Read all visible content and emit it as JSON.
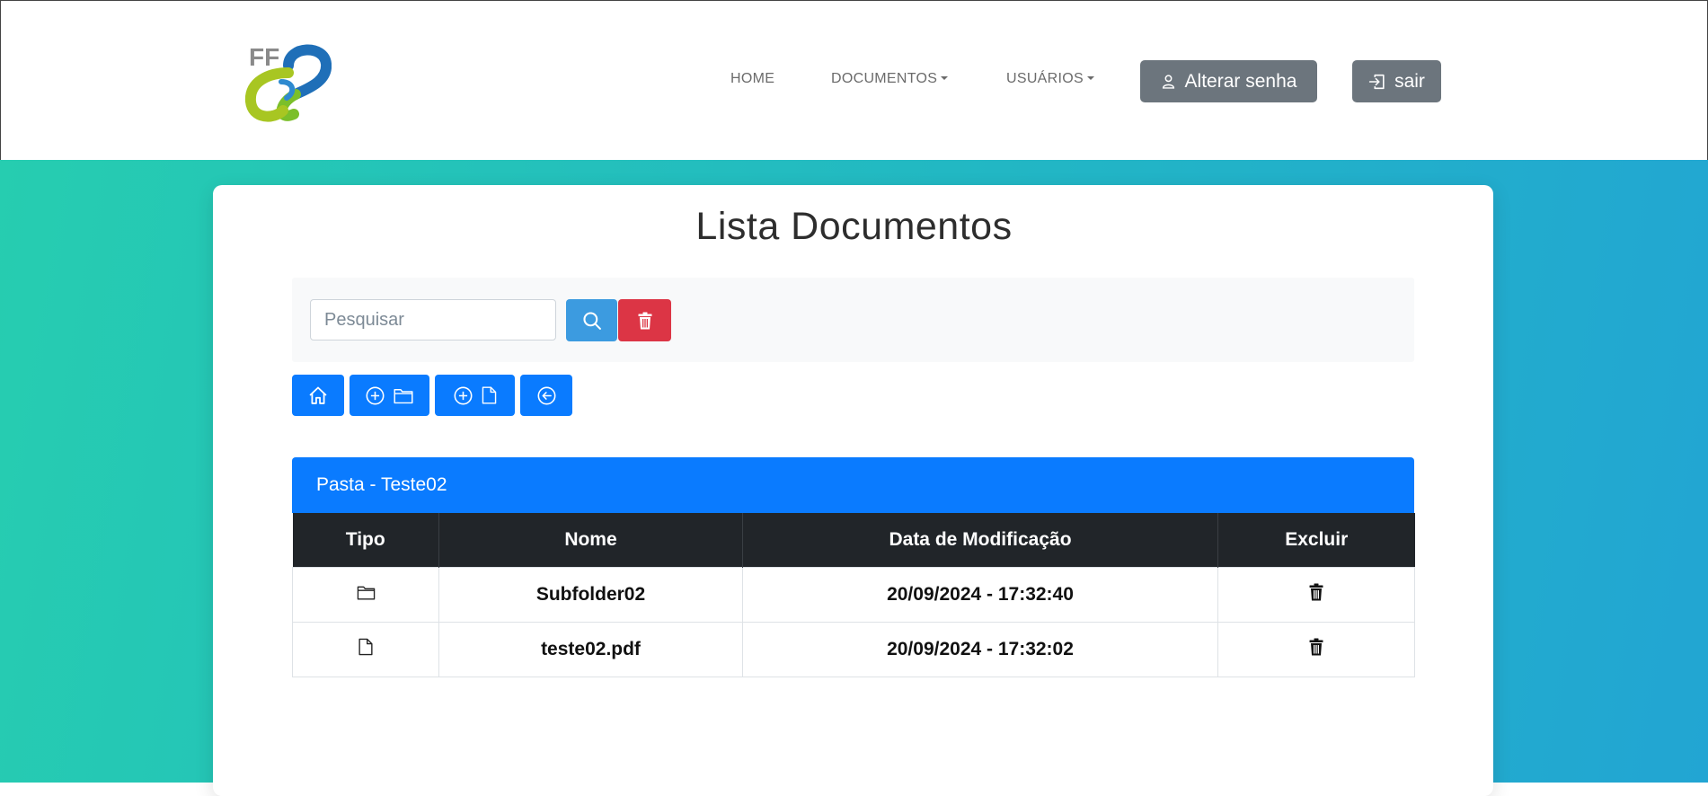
{
  "nav": {
    "logo_text": "FF",
    "links": [
      {
        "label": "HOME"
      },
      {
        "label": "DOCUMENTOS"
      },
      {
        "label": "USUÁRIOS"
      }
    ],
    "change_password_label": "Alterar senha",
    "logout_label": "sair"
  },
  "page": {
    "title": "Lista Documentos"
  },
  "search": {
    "placeholder": "Pesquisar",
    "value": ""
  },
  "table": {
    "header_title": "Pasta - Teste02",
    "columns": [
      "Tipo",
      "Nome",
      "Data de Modificação",
      "Excluir"
    ],
    "rows": [
      {
        "type_icon": "folder-icon",
        "name": "Subfolder02",
        "modified": "20/09/2024 - 17:32:40",
        "delete_icon": "trash-icon"
      },
      {
        "type_icon": "file-icon",
        "name": "teste02.pdf",
        "modified": "20/09/2024 - 17:32:02",
        "delete_icon": "trash-icon"
      }
    ]
  },
  "colors": {
    "primary": "#0a7bff",
    "danger": "#dc3545",
    "search_button": "#3c9be0",
    "secondary": "#6c757d",
    "table_head": "#212529",
    "background_gradient_start": "#26cdb0",
    "background_gradient_end": "#22a5d3"
  },
  "icons": {
    "toolbar": [
      "home-icon",
      "add-folder-icon",
      "add-file-icon",
      "back-icon"
    ],
    "search_button": "search-icon",
    "clear_button": "trash-icon",
    "change_password": "user-icon",
    "logout": "logout-icon"
  }
}
